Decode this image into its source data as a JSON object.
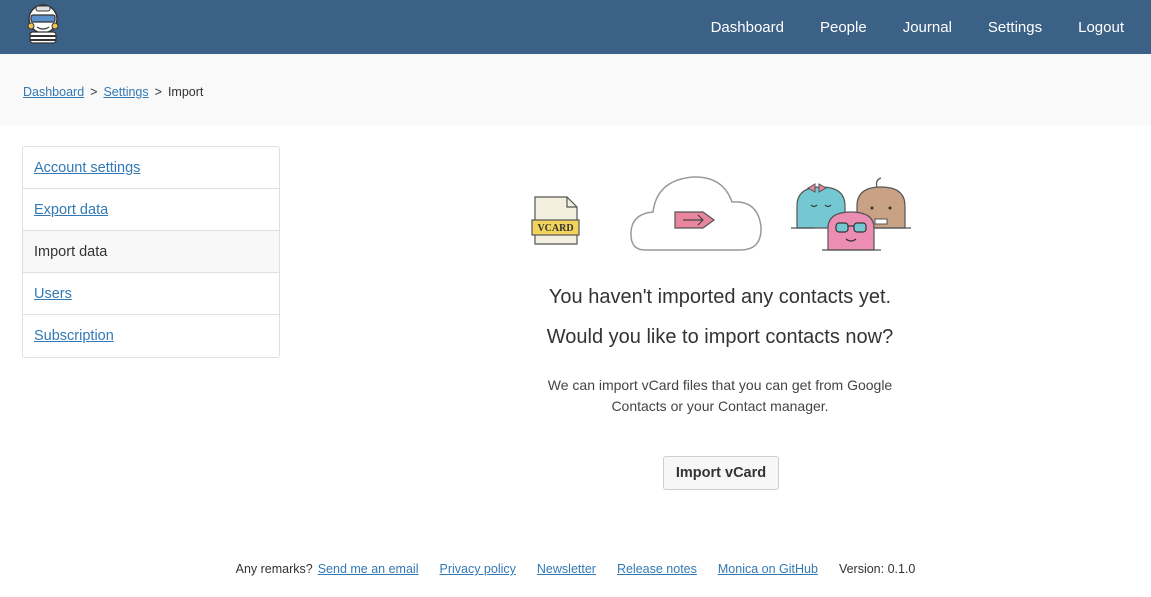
{
  "header": {
    "nav": [
      "Dashboard",
      "People",
      "Journal",
      "Settings",
      "Logout"
    ],
    "bg_color": "#3c6186"
  },
  "breadcrumb": {
    "items": [
      "Dashboard",
      "Settings"
    ],
    "separator": ">",
    "current": "Import"
  },
  "sidebar": {
    "items": [
      {
        "label": "Account settings",
        "link": true
      },
      {
        "label": "Export data",
        "link": true
      },
      {
        "label": "Import data",
        "link": false
      },
      {
        "label": "Users",
        "link": true
      },
      {
        "label": "Subscription",
        "link": true
      }
    ]
  },
  "illustration": {
    "vcard_label": "VCARD"
  },
  "main": {
    "title": "You haven't imported any contacts yet.",
    "subtitle": "Would you like to import contacts now?",
    "description_line1": "We can import vCard files that you can get from Google",
    "description_line2": "Contacts or your Contact manager.",
    "button": "Import vCard"
  },
  "footer": {
    "remarks": "Any remarks?",
    "email_link": "Send me an email",
    "links": [
      "Privacy policy",
      "Newsletter",
      "Release notes",
      "Monica on GitHub"
    ],
    "version": "Version: 0.1.0"
  },
  "colors": {
    "link": "#3279b5",
    "header": "#3c6186"
  }
}
